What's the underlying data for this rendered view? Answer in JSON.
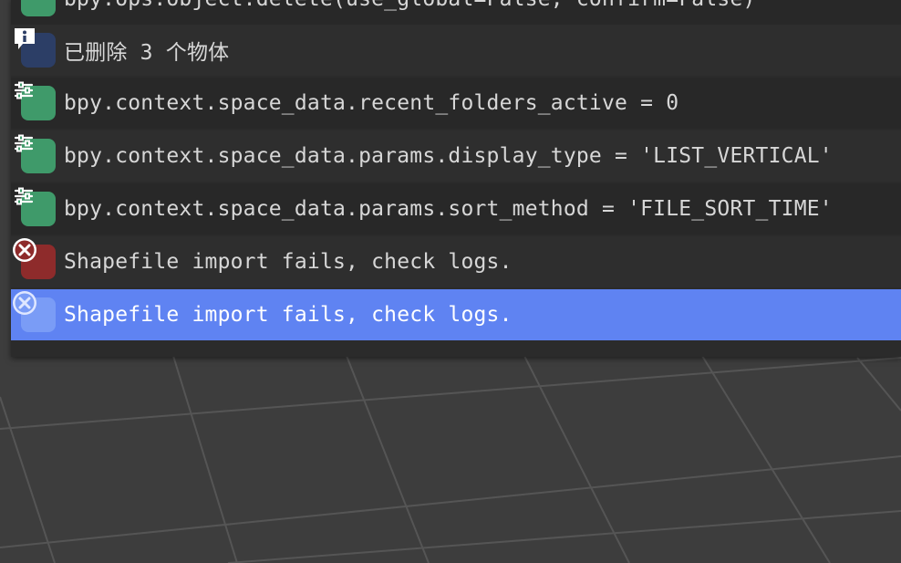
{
  "colors": {
    "viewport_bg": "#3d3d3d",
    "grid_line": "#555555",
    "panel_bg": "#2b2b2b",
    "selected_bg": "#5f83f2",
    "property_icon": "#3f9a6a",
    "info_icon": "#2c3e66",
    "error_icon": "#8e2b2b"
  },
  "report_log": {
    "rows": [
      {
        "icon": "property-icon",
        "text": "bpy.ops.object.delete(use_global=False, confirm=False)"
      },
      {
        "icon": "info-icon",
        "text": "已删除 3 个物体"
      },
      {
        "icon": "property-icon",
        "text": "bpy.context.space_data.recent_folders_active = 0"
      },
      {
        "icon": "property-icon",
        "text": "bpy.context.space_data.params.display_type = 'LIST_VERTICAL'"
      },
      {
        "icon": "property-icon",
        "text": "bpy.context.space_data.params.sort_method = 'FILE_SORT_TIME'"
      },
      {
        "icon": "error-icon",
        "text": "Shapefile import fails, check logs."
      },
      {
        "icon": "error-icon",
        "text": "Shapefile import fails, check logs.",
        "selected": true
      }
    ]
  }
}
